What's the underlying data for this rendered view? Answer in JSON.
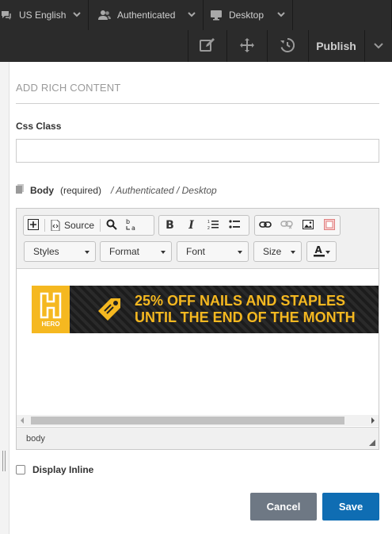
{
  "topbar": {
    "language": "US English",
    "role": "Authenticated",
    "device": "Desktop"
  },
  "actionbar": {
    "publish_label": "Publish"
  },
  "panel": {
    "title": "ADD RICH CONTENT",
    "css_class_label": "Css Class",
    "css_class_value": "",
    "body_label": "Body",
    "body_required": "(required)",
    "body_path": "/ Authenticated / Desktop"
  },
  "editor": {
    "source_label": "Source",
    "styles_label": "Styles",
    "format_label": "Format",
    "font_label": "Font",
    "size_label": "Size",
    "status_path": "body",
    "banner": {
      "badge_text": "HERO",
      "line1": "25% OFF NAILS AND STAPLES",
      "line2": "UNTIL THE END OF THE MONTH"
    }
  },
  "display_inline_label": "Display Inline",
  "buttons": {
    "cancel": "Cancel",
    "save": "Save"
  },
  "colors": {
    "topbar_bg": "#2b2b2b",
    "banner_accent": "#f5b820",
    "save_button": "#0f6db3",
    "cancel_button": "#6e7884"
  }
}
